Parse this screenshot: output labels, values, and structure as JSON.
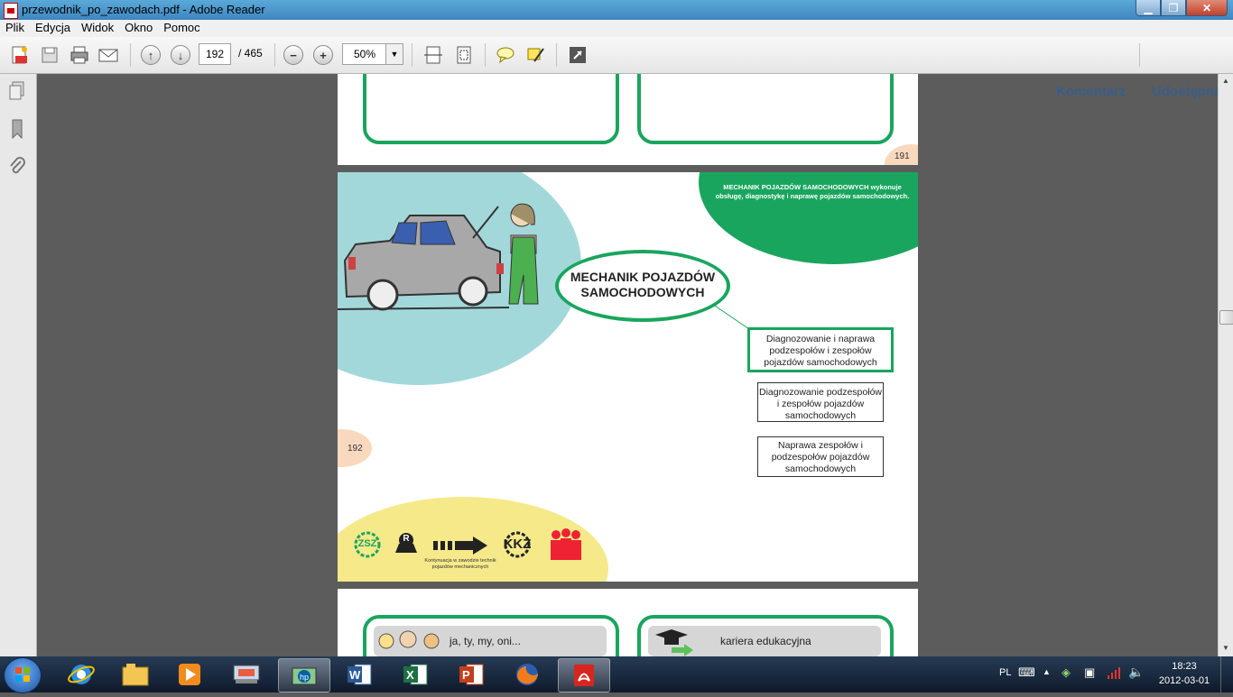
{
  "window": {
    "title": "przewodnik_po_zawodach.pdf - Adobe Reader"
  },
  "menu": [
    "Plik",
    "Edycja",
    "Widok",
    "Okno",
    "Pomoc"
  ],
  "toolbar": {
    "page_current": "192",
    "page_total": "/ 465",
    "zoom": "50%",
    "comment_label": "Komentarz",
    "share_label": "Udostępnij"
  },
  "page191": {
    "number": "191"
  },
  "page192": {
    "number": "192",
    "title_line1": "MECHANIK POJAZDÓW",
    "title_line2": "SAMOCHODOWYCH",
    "description": "MECHANIK POJAZDÓW SAMOCHODOWYCH wykonuje obsługę, diagnostykę i naprawę pojazdów samochodowych.",
    "qual_main": "Diagnozowanie i naprawa podzespołów i zespołów pojazdów samochodowych",
    "qual_sub1": "Diagnozowanie podzespołów i zespołów pojazdów samochodowych",
    "qual_sub2": "Naprawa zespołów i podzespołów pojazdów samochodowych",
    "footer_zsz": "ZSZ",
    "footer_kkz": "KKZ",
    "footer_r": "R",
    "footer_caption": "Kontynuacja w zawodzie technik pojazdów mechanicznych"
  },
  "page193": {
    "card_left": "ja, ty, my, oni...",
    "card_right": "kariera edukacyjna"
  },
  "taskbar": {
    "language": "PL",
    "time": "18:23",
    "date": "2012-03-01",
    "apps": [
      "explorer-icon",
      "ie-icon",
      "libraries-icon",
      "media-player-icon",
      "presentation-icon",
      "hp-icon",
      "word-icon",
      "excel-icon",
      "powerpoint-icon",
      "firefox-icon",
      "adobe-reader-icon"
    ]
  },
  "colors": {
    "green": "#1aa55e",
    "teal": "#a3d8db",
    "yellow": "#f5e98a",
    "peach": "#f9d9bd"
  }
}
